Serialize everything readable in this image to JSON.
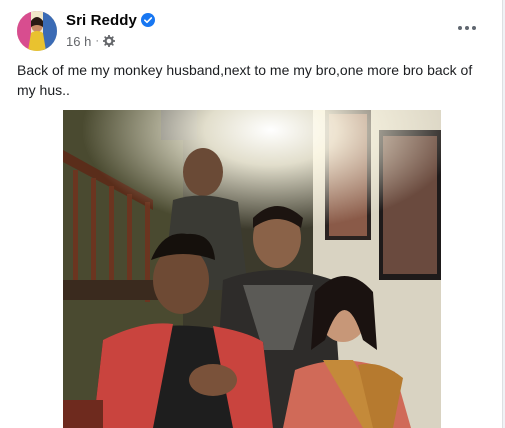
{
  "post": {
    "author_name": "Sri Reddy",
    "timestamp": "16 h",
    "separator": "·",
    "text": "Back of me my monkey husband,next to me my bro,one more bro back of my hus..",
    "icons": {
      "verified": "verified-badge-icon",
      "audience": "gear-icon",
      "more": "more-options-icon"
    },
    "colors": {
      "verified": "#1877f2",
      "meta_text": "#65676b",
      "body_text": "#1c1e21"
    }
  }
}
